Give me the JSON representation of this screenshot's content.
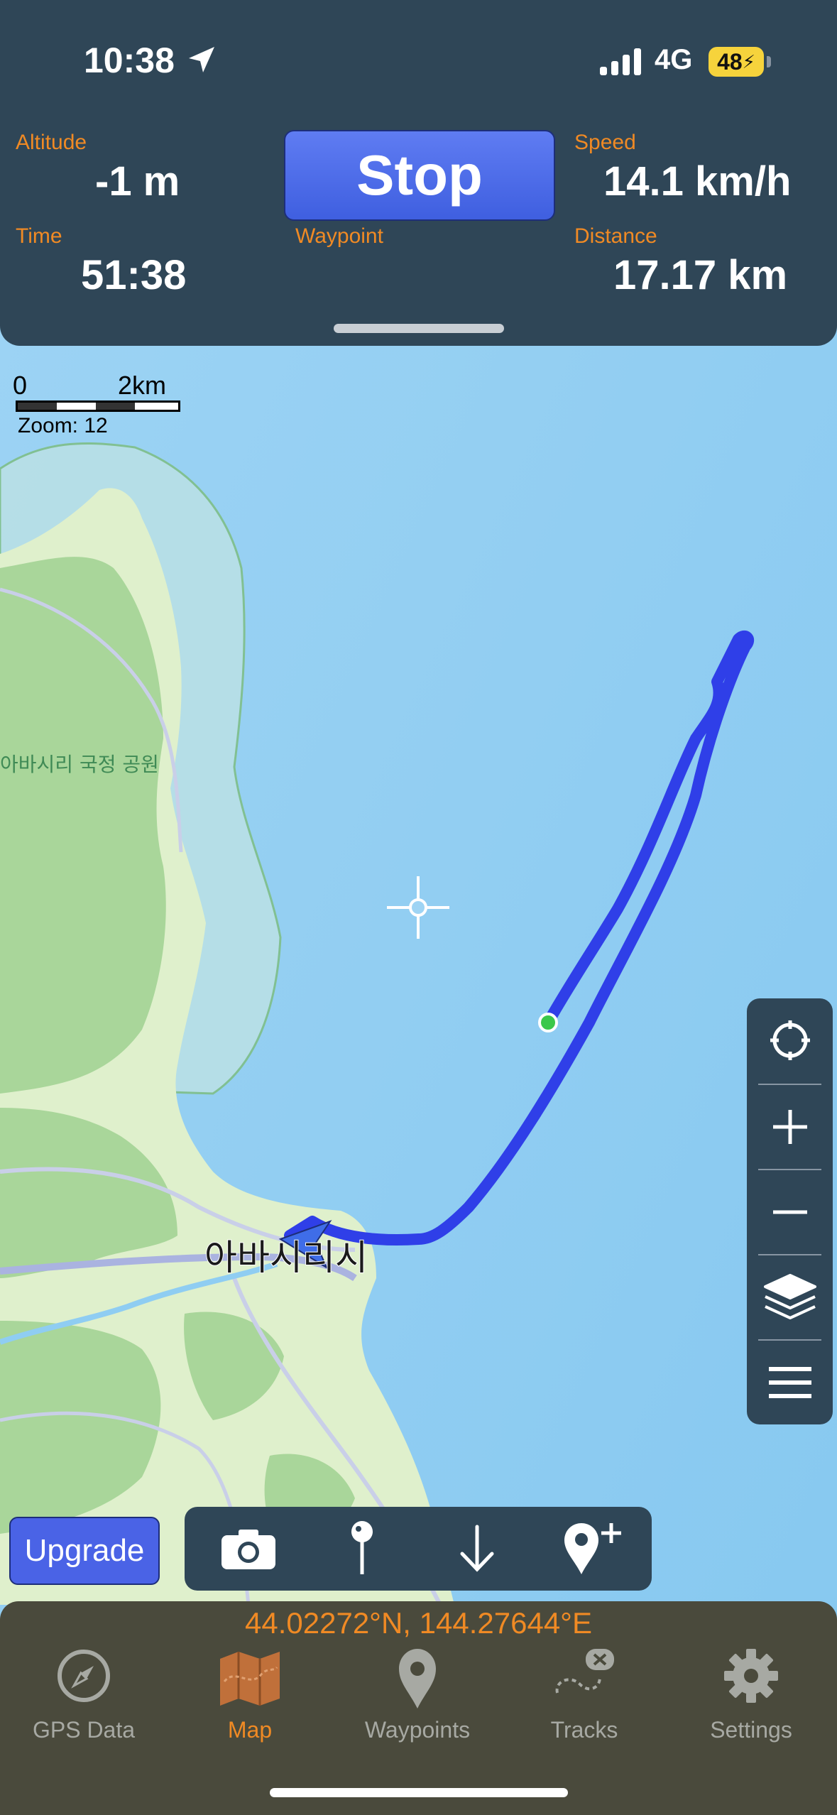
{
  "status_bar": {
    "time": "10:38",
    "network": "4G",
    "battery": "48"
  },
  "stats": {
    "altitude": {
      "label": "Altitude",
      "value": "-1 m"
    },
    "time": {
      "label": "Time",
      "value": "51:38"
    },
    "waypoint": {
      "label": "Waypoint",
      "value": ""
    },
    "speed": {
      "label": "Speed",
      "value": "14.1 km/h"
    },
    "distance": {
      "label": "Distance",
      "value": "17.17 km"
    }
  },
  "stop_label": "Stop",
  "map": {
    "scale_start": "0",
    "scale_end": "2km",
    "zoom": "Zoom: 12",
    "park_label": "아바시리 국정 공원",
    "city_label": "아바시리시",
    "track_color": "#2f3fe8",
    "land_color": "#a9d69a",
    "water_color": "#8fcdf2"
  },
  "controls": [
    "locate-icon",
    "zoom-in-icon",
    "zoom-out-icon",
    "layers-icon",
    "menu-icon"
  ],
  "upgrade_label": "Upgrade",
  "actions": [
    "camera-icon",
    "pin-icon",
    "download-arrow-icon",
    "add-waypoint-icon"
  ],
  "coordinates": "44.02272°N, 144.27644°E",
  "tabs": [
    {
      "label": "GPS Data",
      "icon": "compass-icon"
    },
    {
      "label": "Map",
      "icon": "map-icon",
      "active": true
    },
    {
      "label": "Waypoints",
      "icon": "waypoint-pin-icon"
    },
    {
      "label": "Tracks",
      "icon": "tracks-icon"
    },
    {
      "label": "Settings",
      "icon": "gear-icon"
    }
  ],
  "colors": {
    "panel": "#2f4657",
    "accent": "#f08a24",
    "button": "#4a63e6"
  }
}
